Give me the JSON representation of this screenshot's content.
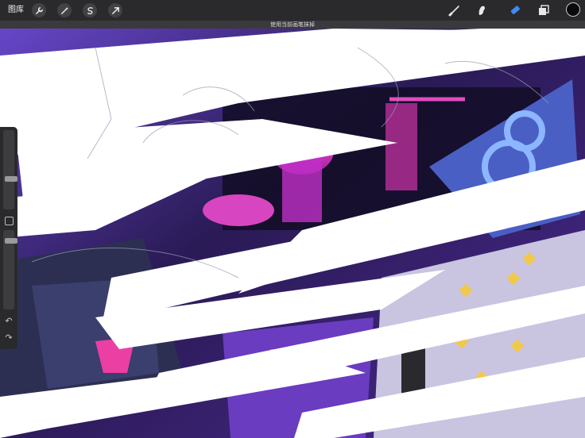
{
  "topbar": {
    "gallery_label": "图库",
    "left_tools": [
      "wrench-icon",
      "magic-wand-icon",
      "selection-icon",
      "transform-arrow-icon"
    ],
    "right_tools": [
      "brush-icon",
      "smudge-icon",
      "eraser-icon",
      "layers-icon"
    ],
    "active_tool": "eraser",
    "accent": "#3d8bf5",
    "current_color": "#000000"
  },
  "hint": "使用当前画笔抹掉",
  "sidebar": {
    "brush_size_level": 0.28,
    "opacity_level": 0.65
  }
}
